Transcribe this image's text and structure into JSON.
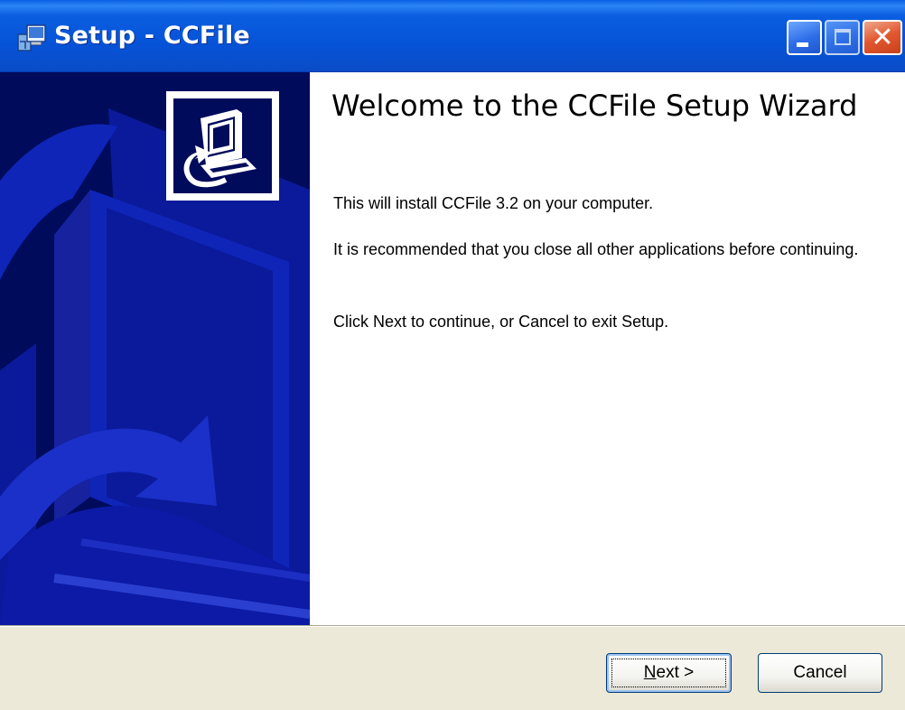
{
  "window": {
    "title": "Setup - CCFile",
    "icon": "setup-icon",
    "controls": [
      "minimize-icon",
      "maximize-icon",
      "close-icon"
    ]
  },
  "wizard": {
    "heading": "Welcome to the CCFile Setup Wizard",
    "paragraphs": [
      "This will install CCFile 3.2 on your computer.",
      "It is recommended that you close all other applications before continuing.",
      "Click Next to continue, or Cancel to exit Setup."
    ],
    "logo": "computer-install-icon"
  },
  "buttons": {
    "next_mnemonic": "N",
    "next_rest": "ext >",
    "cancel_label": "Cancel"
  },
  "colors": {
    "titlebar": "#0653d8",
    "side_panel": "#000b5c",
    "dialog_face": "#ece9d8"
  }
}
